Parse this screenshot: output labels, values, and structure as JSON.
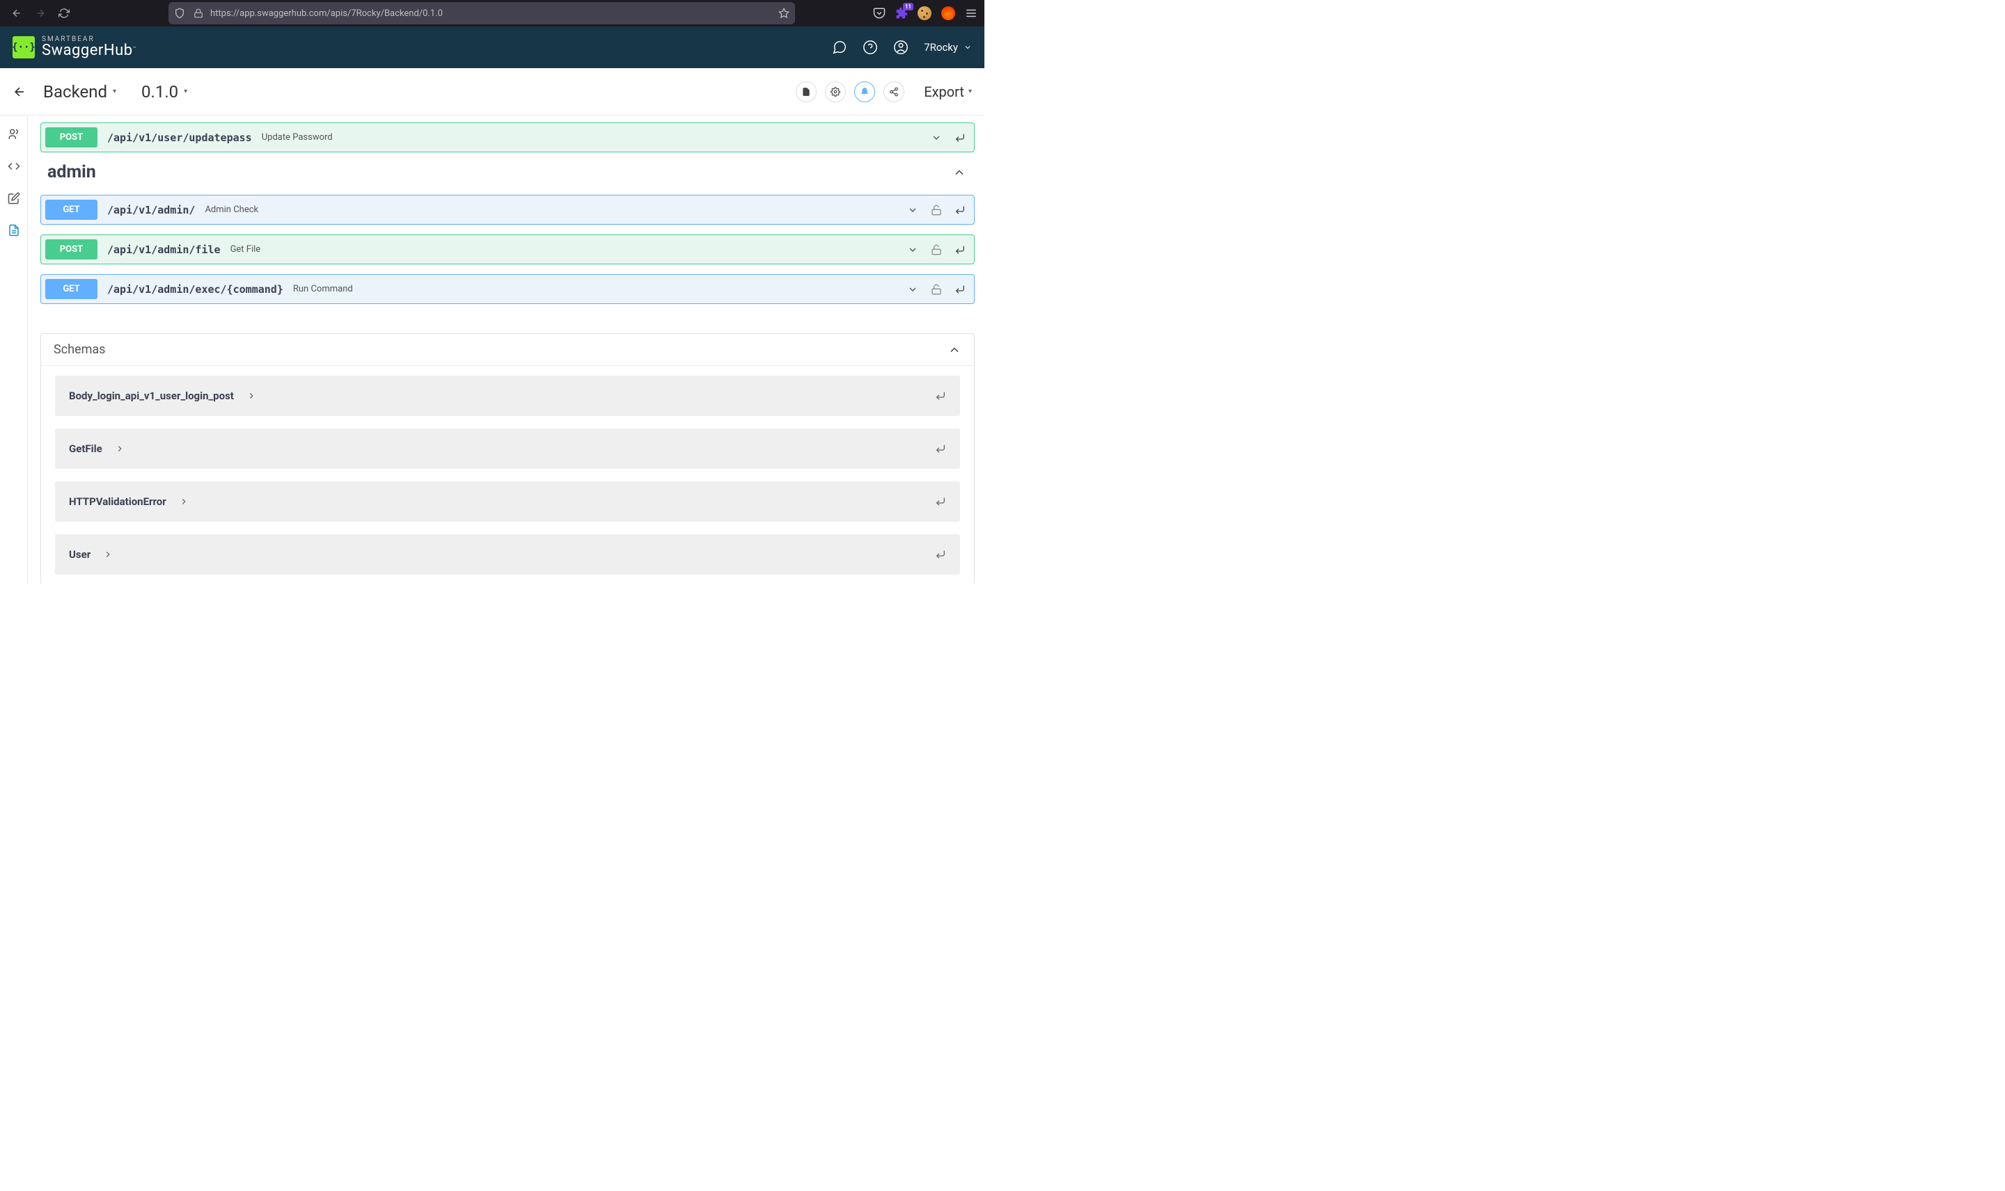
{
  "browser": {
    "url": "https://app.swaggerhub.com/apis/7Rocky/Backend/0.1.0",
    "badge": "11"
  },
  "header": {
    "brand_small": "SMARTBEAR",
    "brand_big": "SwaggerHub",
    "username": "7Rocky"
  },
  "subheader": {
    "api_name": "Backend",
    "version": "0.1.0",
    "export_label": "Export"
  },
  "endpoints": {
    "top": {
      "method": "POST",
      "path": "/api/v1/user/updatepass",
      "summary": "Update Password"
    },
    "tag": "admin",
    "list": [
      {
        "method": "GET",
        "path": "/api/v1/admin/",
        "summary": "Admin Check"
      },
      {
        "method": "POST",
        "path": "/api/v1/admin/file",
        "summary": "Get File"
      },
      {
        "method": "GET",
        "path": "/api/v1/admin/exec/{command}",
        "summary": "Run Command"
      }
    ]
  },
  "schemas": {
    "title": "Schemas",
    "list": [
      {
        "name": "Body_login_api_v1_user_login_post"
      },
      {
        "name": "GetFile"
      },
      {
        "name": "HTTPValidationError"
      },
      {
        "name": "User"
      }
    ]
  }
}
